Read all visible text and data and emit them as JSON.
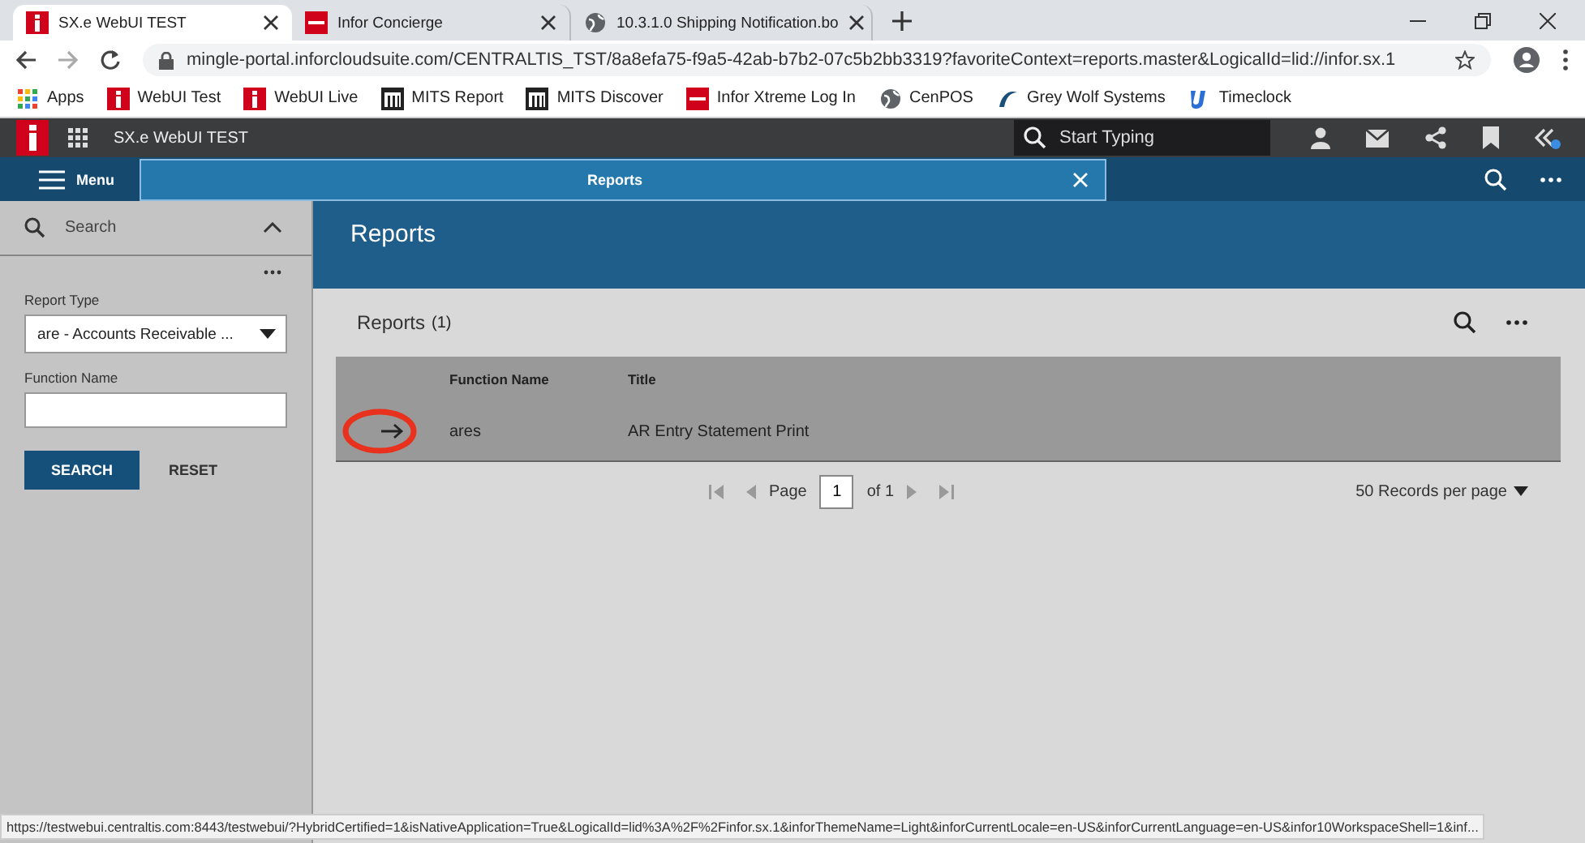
{
  "browser": {
    "tabs": [
      {
        "title": "SX.e WebUI TEST",
        "selected": true
      },
      {
        "title": "Infor Concierge",
        "selected": false
      },
      {
        "title": "10.3.1.0 Shipping Notification.bo",
        "selected": false
      }
    ],
    "url": "mingle-portal.inforcloudsuite.com/CENTRALTIS_TST/8a8efa75-f9a5-42ab-b7b2-07c5b2bb3319?favoriteContext=reports.master&LogicalId=lid://infor.sx.1",
    "bookmarks": [
      {
        "label": "Apps"
      },
      {
        "label": "WebUI Test"
      },
      {
        "label": "WebUI Live"
      },
      {
        "label": "MITS Report"
      },
      {
        "label": "MITS Discover"
      },
      {
        "label": "Infor Xtreme Log In"
      },
      {
        "label": "CenPOS"
      },
      {
        "label": "Grey Wolf Systems"
      },
      {
        "label": "Timeclock"
      }
    ]
  },
  "app": {
    "title": "SX.e WebUI TEST",
    "search_placeholder": "Start Typing",
    "menu_label": "Menu",
    "tabs": [
      {
        "label": "Reports",
        "selected": true
      }
    ]
  },
  "sidebar": {
    "search_label": "Search",
    "report_type_label": "Report Type",
    "report_type_value": "are - Accounts Receivable ...",
    "function_name_label": "Function Name",
    "search_button": "SEARCH",
    "reset_button": "RESET"
  },
  "content": {
    "title": "Reports",
    "grid_title": "Reports",
    "grid_count": "(1)",
    "columns": [
      "Function Name",
      "Title"
    ],
    "rows": [
      {
        "function_name": "ares",
        "title": "AR Entry Statement Print",
        "circled": true
      }
    ],
    "pager": {
      "page_label": "Page",
      "page_value": "1",
      "of_label": "of 1",
      "records_per_page": "50 Records per page"
    }
  },
  "status_url": "https://testwebui.centraltis.com:8443/testwebui/?HybridCertified=1&isNativeApplication=True&LogicalId=lid%3A%2F%2Finfor.sx.1&inforThemeName=Light&inforCurrentLocale=en-US&inforCurrentLanguage=en-US&infor10WorkspaceShell=1&inf..."
}
